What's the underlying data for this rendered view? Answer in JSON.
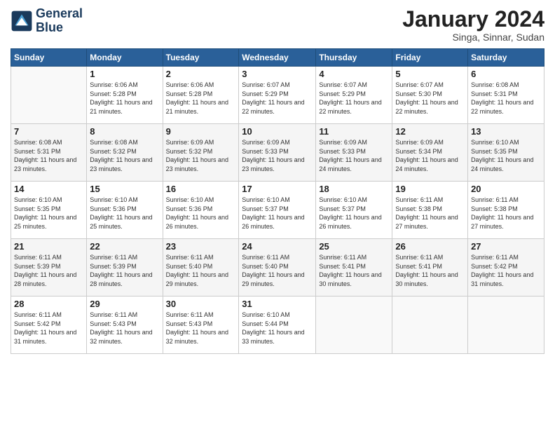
{
  "logo": {
    "line1": "General",
    "line2": "Blue"
  },
  "title": "January 2024",
  "location": "Singa, Sinnar, Sudan",
  "weekdays": [
    "Sunday",
    "Monday",
    "Tuesday",
    "Wednesday",
    "Thursday",
    "Friday",
    "Saturday"
  ],
  "weeks": [
    [
      {
        "day": "",
        "sunrise": "",
        "sunset": "",
        "daylight": ""
      },
      {
        "day": "1",
        "sunrise": "Sunrise: 6:06 AM",
        "sunset": "Sunset: 5:28 PM",
        "daylight": "Daylight: 11 hours and 21 minutes."
      },
      {
        "day": "2",
        "sunrise": "Sunrise: 6:06 AM",
        "sunset": "Sunset: 5:28 PM",
        "daylight": "Daylight: 11 hours and 21 minutes."
      },
      {
        "day": "3",
        "sunrise": "Sunrise: 6:07 AM",
        "sunset": "Sunset: 5:29 PM",
        "daylight": "Daylight: 11 hours and 22 minutes."
      },
      {
        "day": "4",
        "sunrise": "Sunrise: 6:07 AM",
        "sunset": "Sunset: 5:29 PM",
        "daylight": "Daylight: 11 hours and 22 minutes."
      },
      {
        "day": "5",
        "sunrise": "Sunrise: 6:07 AM",
        "sunset": "Sunset: 5:30 PM",
        "daylight": "Daylight: 11 hours and 22 minutes."
      },
      {
        "day": "6",
        "sunrise": "Sunrise: 6:08 AM",
        "sunset": "Sunset: 5:31 PM",
        "daylight": "Daylight: 11 hours and 22 minutes."
      }
    ],
    [
      {
        "day": "7",
        "sunrise": "Sunrise: 6:08 AM",
        "sunset": "Sunset: 5:31 PM",
        "daylight": "Daylight: 11 hours and 23 minutes."
      },
      {
        "day": "8",
        "sunrise": "Sunrise: 6:08 AM",
        "sunset": "Sunset: 5:32 PM",
        "daylight": "Daylight: 11 hours and 23 minutes."
      },
      {
        "day": "9",
        "sunrise": "Sunrise: 6:09 AM",
        "sunset": "Sunset: 5:32 PM",
        "daylight": "Daylight: 11 hours and 23 minutes."
      },
      {
        "day": "10",
        "sunrise": "Sunrise: 6:09 AM",
        "sunset": "Sunset: 5:33 PM",
        "daylight": "Daylight: 11 hours and 23 minutes."
      },
      {
        "day": "11",
        "sunrise": "Sunrise: 6:09 AM",
        "sunset": "Sunset: 5:33 PM",
        "daylight": "Daylight: 11 hours and 24 minutes."
      },
      {
        "day": "12",
        "sunrise": "Sunrise: 6:09 AM",
        "sunset": "Sunset: 5:34 PM",
        "daylight": "Daylight: 11 hours and 24 minutes."
      },
      {
        "day": "13",
        "sunrise": "Sunrise: 6:10 AM",
        "sunset": "Sunset: 5:35 PM",
        "daylight": "Daylight: 11 hours and 24 minutes."
      }
    ],
    [
      {
        "day": "14",
        "sunrise": "Sunrise: 6:10 AM",
        "sunset": "Sunset: 5:35 PM",
        "daylight": "Daylight: 11 hours and 25 minutes."
      },
      {
        "day": "15",
        "sunrise": "Sunrise: 6:10 AM",
        "sunset": "Sunset: 5:36 PM",
        "daylight": "Daylight: 11 hours and 25 minutes."
      },
      {
        "day": "16",
        "sunrise": "Sunrise: 6:10 AM",
        "sunset": "Sunset: 5:36 PM",
        "daylight": "Daylight: 11 hours and 26 minutes."
      },
      {
        "day": "17",
        "sunrise": "Sunrise: 6:10 AM",
        "sunset": "Sunset: 5:37 PM",
        "daylight": "Daylight: 11 hours and 26 minutes."
      },
      {
        "day": "18",
        "sunrise": "Sunrise: 6:10 AM",
        "sunset": "Sunset: 5:37 PM",
        "daylight": "Daylight: 11 hours and 26 minutes."
      },
      {
        "day": "19",
        "sunrise": "Sunrise: 6:11 AM",
        "sunset": "Sunset: 5:38 PM",
        "daylight": "Daylight: 11 hours and 27 minutes."
      },
      {
        "day": "20",
        "sunrise": "Sunrise: 6:11 AM",
        "sunset": "Sunset: 5:38 PM",
        "daylight": "Daylight: 11 hours and 27 minutes."
      }
    ],
    [
      {
        "day": "21",
        "sunrise": "Sunrise: 6:11 AM",
        "sunset": "Sunset: 5:39 PM",
        "daylight": "Daylight: 11 hours and 28 minutes."
      },
      {
        "day": "22",
        "sunrise": "Sunrise: 6:11 AM",
        "sunset": "Sunset: 5:39 PM",
        "daylight": "Daylight: 11 hours and 28 minutes."
      },
      {
        "day": "23",
        "sunrise": "Sunrise: 6:11 AM",
        "sunset": "Sunset: 5:40 PM",
        "daylight": "Daylight: 11 hours and 29 minutes."
      },
      {
        "day": "24",
        "sunrise": "Sunrise: 6:11 AM",
        "sunset": "Sunset: 5:40 PM",
        "daylight": "Daylight: 11 hours and 29 minutes."
      },
      {
        "day": "25",
        "sunrise": "Sunrise: 6:11 AM",
        "sunset": "Sunset: 5:41 PM",
        "daylight": "Daylight: 11 hours and 30 minutes."
      },
      {
        "day": "26",
        "sunrise": "Sunrise: 6:11 AM",
        "sunset": "Sunset: 5:41 PM",
        "daylight": "Daylight: 11 hours and 30 minutes."
      },
      {
        "day": "27",
        "sunrise": "Sunrise: 6:11 AM",
        "sunset": "Sunset: 5:42 PM",
        "daylight": "Daylight: 11 hours and 31 minutes."
      }
    ],
    [
      {
        "day": "28",
        "sunrise": "Sunrise: 6:11 AM",
        "sunset": "Sunset: 5:42 PM",
        "daylight": "Daylight: 11 hours and 31 minutes."
      },
      {
        "day": "29",
        "sunrise": "Sunrise: 6:11 AM",
        "sunset": "Sunset: 5:43 PM",
        "daylight": "Daylight: 11 hours and 32 minutes."
      },
      {
        "day": "30",
        "sunrise": "Sunrise: 6:11 AM",
        "sunset": "Sunset: 5:43 PM",
        "daylight": "Daylight: 11 hours and 32 minutes."
      },
      {
        "day": "31",
        "sunrise": "Sunrise: 6:10 AM",
        "sunset": "Sunset: 5:44 PM",
        "daylight": "Daylight: 11 hours and 33 minutes."
      },
      {
        "day": "",
        "sunrise": "",
        "sunset": "",
        "daylight": ""
      },
      {
        "day": "",
        "sunrise": "",
        "sunset": "",
        "daylight": ""
      },
      {
        "day": "",
        "sunrise": "",
        "sunset": "",
        "daylight": ""
      }
    ]
  ]
}
